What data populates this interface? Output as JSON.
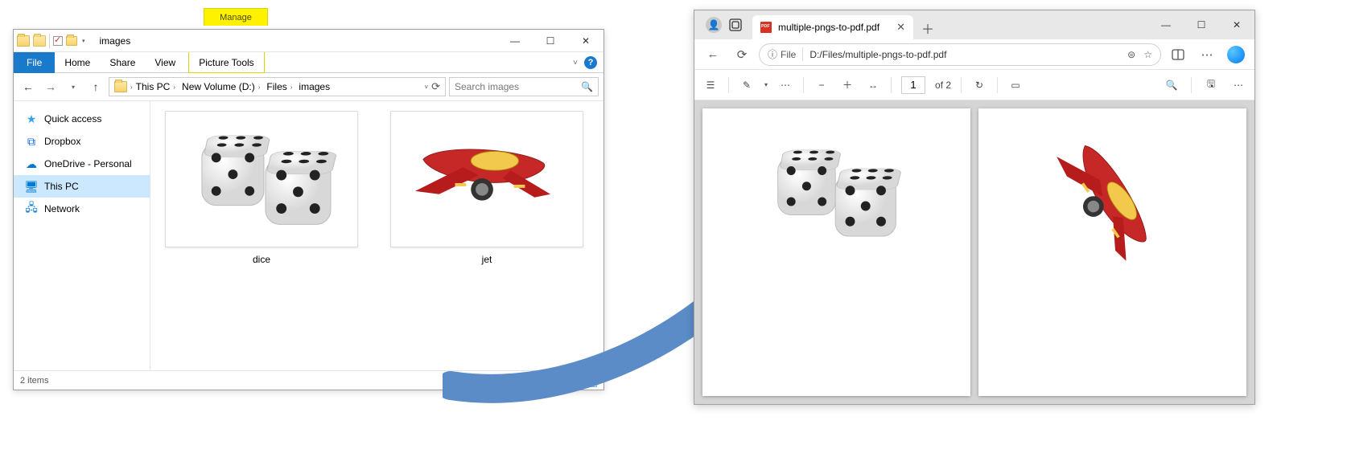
{
  "explorer": {
    "titlebar": {
      "title": "images"
    },
    "ribbon": {
      "manage": "Manage",
      "file": "File",
      "home": "Home",
      "share": "Share",
      "view": "View",
      "picture_tools": "Picture Tools"
    },
    "breadcrumb": {
      "segments": [
        "This PC",
        "New Volume (D:)",
        "Files",
        "images"
      ]
    },
    "search": {
      "placeholder": "Search images"
    },
    "sidebar": {
      "items": [
        {
          "label": "Quick access"
        },
        {
          "label": "Dropbox"
        },
        {
          "label": "OneDrive - Personal"
        },
        {
          "label": "This PC"
        },
        {
          "label": "Network"
        }
      ],
      "selected_index": 3
    },
    "files": [
      {
        "name": "dice"
      },
      {
        "name": "jet"
      }
    ],
    "status": {
      "text": "2 items"
    }
  },
  "edge": {
    "tab": {
      "title": "multiple-pngs-to-pdf.pdf"
    },
    "addressbar": {
      "scheme_label": "File",
      "url": "D:/Files/multiple-pngs-to-pdf.pdf"
    },
    "pdf_toolbar": {
      "page_current": "1",
      "page_total_label": "of 2"
    }
  },
  "colors": {
    "win_accent": "#1979ca",
    "ribbon_yellow": "#fff200",
    "selection": "#cce8ff",
    "pdf_bg": "#d5d5d5",
    "arrow": "#5b8cc7"
  }
}
